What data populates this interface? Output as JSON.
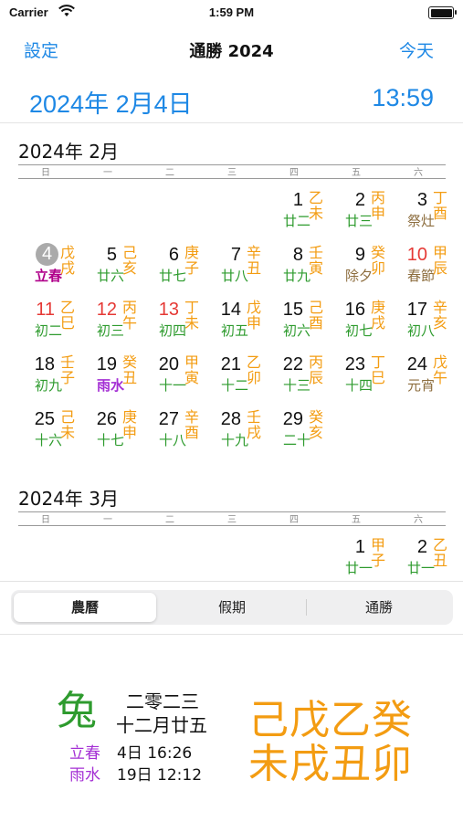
{
  "status": {
    "carrier": "Carrier",
    "time": "1:59 PM"
  },
  "nav": {
    "left": "設定",
    "title": "通勝 2024",
    "right": "今天"
  },
  "header": {
    "date": "2024年 2月4日",
    "clock": "13:59"
  },
  "weekdays": [
    "日",
    "一",
    "二",
    "三",
    "四",
    "五",
    "六"
  ],
  "colors": {
    "accent": "#1e88e5",
    "green": "#2e9b2e",
    "orange": "#f39c12",
    "red": "#e53935",
    "purple": "#a42fd4",
    "brown": "#8d6e3f",
    "magenta": "#b0008a"
  },
  "months": [
    {
      "title": "2024年 2月",
      "days": [
        {
          "day": "1",
          "gz": "乙未",
          "lunar": "廿二",
          "lunarColor": "green",
          "dayColor": "black",
          "col": 4,
          "row": 0
        },
        {
          "day": "2",
          "gz": "丙申",
          "lunar": "廿三",
          "lunarColor": "green",
          "dayColor": "black",
          "col": 5,
          "row": 0
        },
        {
          "day": "3",
          "gz": "丁酉",
          "lunar": "祭灶",
          "lunarColor": "brown",
          "dayColor": "black",
          "col": 6,
          "row": 0
        },
        {
          "day": "4",
          "gz": "戊戌",
          "lunar": "立春",
          "lunarColor": "magenta",
          "dayColor": "white",
          "today": true,
          "col": 0,
          "row": 1
        },
        {
          "day": "5",
          "gz": "己亥",
          "lunar": "廿六",
          "lunarColor": "green",
          "dayColor": "black",
          "col": 1,
          "row": 1
        },
        {
          "day": "6",
          "gz": "庚子",
          "lunar": "廿七",
          "lunarColor": "green",
          "dayColor": "black",
          "col": 2,
          "row": 1
        },
        {
          "day": "7",
          "gz": "辛丑",
          "lunar": "廿八",
          "lunarColor": "green",
          "dayColor": "black",
          "col": 3,
          "row": 1
        },
        {
          "day": "8",
          "gz": "壬寅",
          "lunar": "廿九",
          "lunarColor": "green",
          "dayColor": "black",
          "col": 4,
          "row": 1
        },
        {
          "day": "9",
          "gz": "癸卯",
          "lunar": "除夕",
          "lunarColor": "brown",
          "dayColor": "black",
          "col": 5,
          "row": 1
        },
        {
          "day": "10",
          "gz": "甲辰",
          "lunar": "春節",
          "lunarColor": "brown",
          "dayColor": "red",
          "col": 6,
          "row": 1
        },
        {
          "day": "11",
          "gz": "乙巳",
          "lunar": "初二",
          "lunarColor": "green",
          "dayColor": "red",
          "col": 0,
          "row": 2
        },
        {
          "day": "12",
          "gz": "丙午",
          "lunar": "初三",
          "lunarColor": "green",
          "dayColor": "red",
          "col": 1,
          "row": 2
        },
        {
          "day": "13",
          "gz": "丁未",
          "lunar": "初四",
          "lunarColor": "green",
          "dayColor": "red",
          "col": 2,
          "row": 2
        },
        {
          "day": "14",
          "gz": "戊申",
          "lunar": "初五",
          "lunarColor": "green",
          "dayColor": "black",
          "col": 3,
          "row": 2
        },
        {
          "day": "15",
          "gz": "己酉",
          "lunar": "初六",
          "lunarColor": "green",
          "dayColor": "black",
          "col": 4,
          "row": 2
        },
        {
          "day": "16",
          "gz": "庚戌",
          "lunar": "初七",
          "lunarColor": "green",
          "dayColor": "black",
          "col": 5,
          "row": 2
        },
        {
          "day": "17",
          "gz": "辛亥",
          "lunar": "初八",
          "lunarColor": "green",
          "dayColor": "black",
          "col": 6,
          "row": 2
        },
        {
          "day": "18",
          "gz": "壬子",
          "lunar": "初九",
          "lunarColor": "green",
          "dayColor": "black",
          "col": 0,
          "row": 3
        },
        {
          "day": "19",
          "gz": "癸丑",
          "lunar": "雨水",
          "lunarColor": "purple",
          "dayColor": "black",
          "col": 1,
          "row": 3
        },
        {
          "day": "20",
          "gz": "甲寅",
          "lunar": "十一",
          "lunarColor": "green",
          "dayColor": "black",
          "col": 2,
          "row": 3
        },
        {
          "day": "21",
          "gz": "乙卯",
          "lunar": "十二",
          "lunarColor": "green",
          "dayColor": "black",
          "col": 3,
          "row": 3
        },
        {
          "day": "22",
          "gz": "丙辰",
          "lunar": "十三",
          "lunarColor": "green",
          "dayColor": "black",
          "col": 4,
          "row": 3
        },
        {
          "day": "23",
          "gz": "丁巳",
          "lunar": "十四",
          "lunarColor": "green",
          "dayColor": "black",
          "col": 5,
          "row": 3
        },
        {
          "day": "24",
          "gz": "戊午",
          "lunar": "元宵",
          "lunarColor": "brown",
          "dayColor": "black",
          "col": 6,
          "row": 3
        },
        {
          "day": "25",
          "gz": "己未",
          "lunar": "十六",
          "lunarColor": "green",
          "dayColor": "black",
          "col": 0,
          "row": 4
        },
        {
          "day": "26",
          "gz": "庚申",
          "lunar": "十七",
          "lunarColor": "green",
          "dayColor": "black",
          "col": 1,
          "row": 4
        },
        {
          "day": "27",
          "gz": "辛酉",
          "lunar": "十八",
          "lunarColor": "green",
          "dayColor": "black",
          "col": 2,
          "row": 4
        },
        {
          "day": "28",
          "gz": "壬戌",
          "lunar": "十九",
          "lunarColor": "green",
          "dayColor": "black",
          "col": 3,
          "row": 4
        },
        {
          "day": "29",
          "gz": "癸亥",
          "lunar": "二十",
          "lunarColor": "green",
          "dayColor": "black",
          "col": 4,
          "row": 4
        }
      ]
    },
    {
      "title": "2024年 3月",
      "days": [
        {
          "day": "1",
          "gz": "甲子",
          "lunar": "廿一",
          "lunarColor": "green",
          "dayColor": "black",
          "col": 5,
          "row": 0
        },
        {
          "day": "2",
          "gz": "乙丑",
          "lunar": "廿一",
          "lunarColor": "green",
          "dayColor": "black",
          "col": 6,
          "row": 0
        }
      ]
    }
  ],
  "segments": [
    "農曆",
    "假期",
    "通勝"
  ],
  "selected_segment": 0,
  "bottom": {
    "animal": "兔",
    "year": "二零二三",
    "lunar_month": "十二月廿五",
    "term1": "立春",
    "term1_date": "4日 16:26",
    "term2": "雨水",
    "term2_date": "19日 12:12",
    "bazi_stems": "己戊乙癸",
    "bazi_branches": "未戌丑卯"
  }
}
